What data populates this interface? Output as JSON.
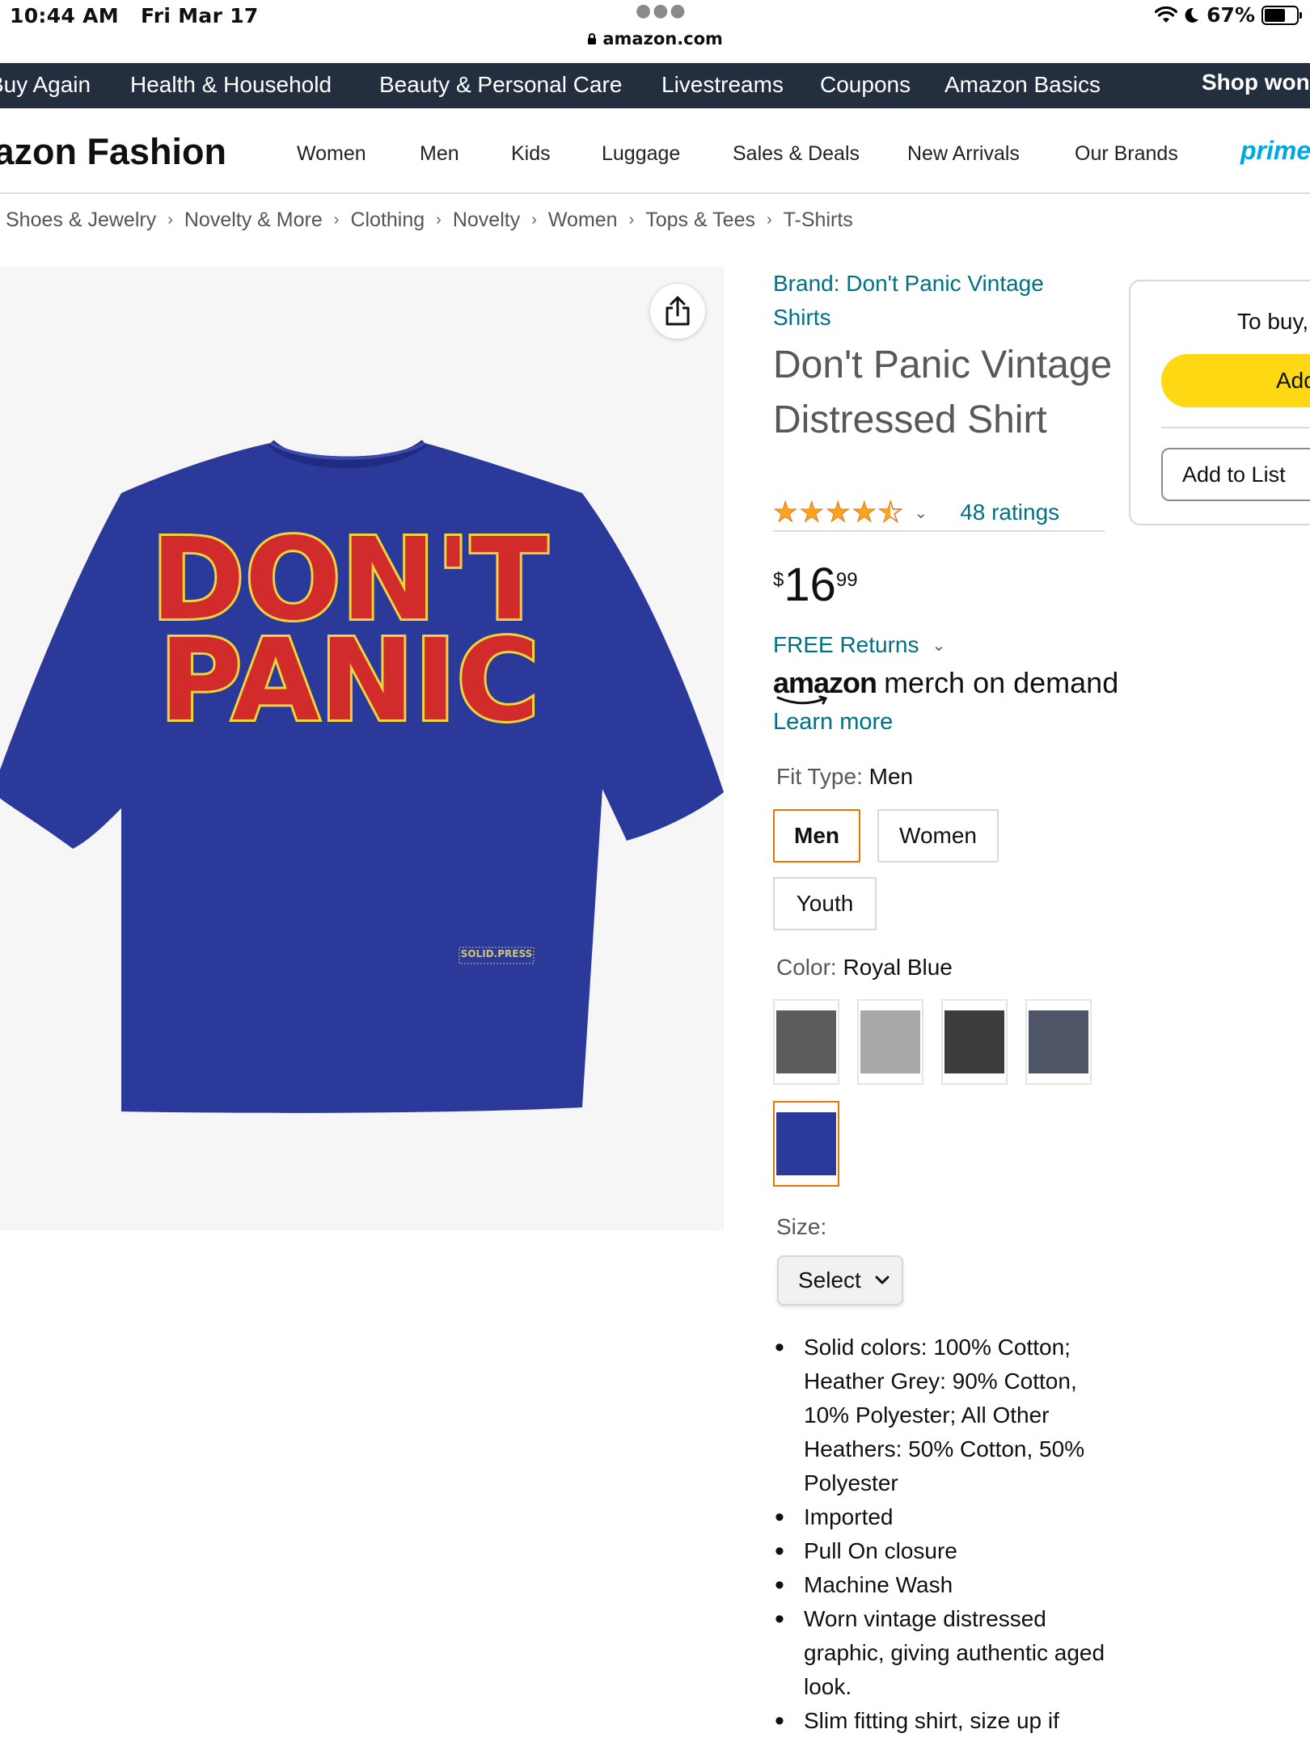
{
  "status_bar": {
    "time": "10:44 AM",
    "date": "Fri Mar 17",
    "battery": "67%",
    "url": "amazon.com"
  },
  "top_nav": {
    "items": [
      "Buy Again",
      "Health & Household",
      "Beauty & Personal Care",
      "Livestreams",
      "Coupons",
      "Amazon Basics"
    ],
    "shop": "Shop won"
  },
  "fashion_nav": {
    "title": "Amazon Fashion",
    "links": [
      "Women",
      "Men",
      "Kids",
      "Luggage",
      "Sales & Deals",
      "New Arrivals",
      "Our Brands"
    ],
    "prime": "prime"
  },
  "breadcrumb": [
    "Shoes & Jewelry",
    "Novelty & More",
    "Clothing",
    "Novelty",
    "Women",
    "Tops & Tees",
    "T-Shirts"
  ],
  "product": {
    "brand": "Brand: Don't Panic Vintage Shirts",
    "title": "Don't Panic Vintage Distressed Shirt",
    "rating": 4.5,
    "ratings_count": "48 ratings",
    "price_symbol": "$",
    "price_whole": "16",
    "price_fraction": "99",
    "free_returns": "FREE Returns",
    "merch_logo": "amazon",
    "merch_text": "merch on demand",
    "learn_more": "Learn more",
    "shirt_text_line1": "DON'T",
    "shirt_text_line2": "PANIC",
    "shirt_tag": "SOLID.PRESS",
    "shirt_color": "#2b3a9a"
  },
  "fit_type": {
    "label": "Fit Type: ",
    "value": "Men",
    "options": [
      "Men",
      "Women",
      "Youth"
    ],
    "selected": "Men"
  },
  "color": {
    "label": "Color: ",
    "value": "Royal Blue",
    "swatches": [
      {
        "name": "dark-heather",
        "hex": "#5c5c5c"
      },
      {
        "name": "heather-grey",
        "hex": "#a9a8a6"
      },
      {
        "name": "charcoal",
        "hex": "#3d3d3f"
      },
      {
        "name": "heather-blue",
        "hex": "#4d5566"
      },
      {
        "name": "royal-blue",
        "hex": "#2b3a9a"
      }
    ],
    "selected": "royal-blue"
  },
  "size": {
    "label": "Size:",
    "select": "Select"
  },
  "bullets": [
    "Solid colors: 100% Cotton; Heather Grey: 90% Cotton, 10% Polyester; All Other Heathers: 50% Cotton, 50% Polyester",
    "Imported",
    "Pull On closure",
    "Machine Wash",
    "Worn vintage distressed graphic, giving authentic aged look.",
    "Slim fitting shirt, size up if"
  ],
  "buy_box": {
    "text": "To buy, select Size",
    "add_to_cart": "Add to Cart",
    "add_to_list": "Add to List"
  },
  "colors": {
    "nav_bg": "#232f3e",
    "link": "#007185",
    "star": "#ffa41c",
    "selected_border": "#e77600",
    "cart_button": "#ffd814"
  }
}
